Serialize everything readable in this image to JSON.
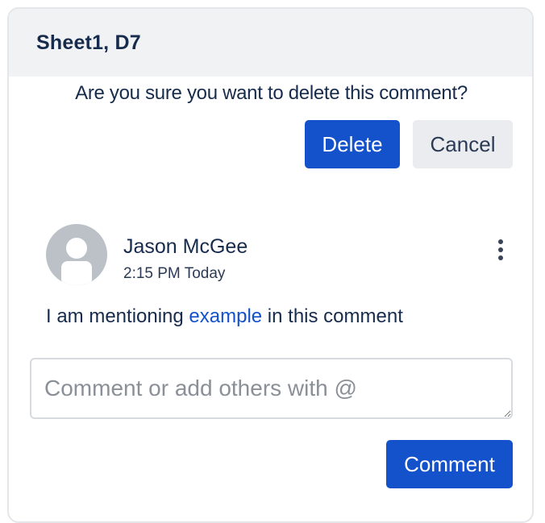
{
  "header": {
    "title": "Sheet1, D7"
  },
  "confirm_dialog": {
    "message": "Are you sure you want to delete this comment?",
    "delete_label": "Delete",
    "cancel_label": "Cancel"
  },
  "comment": {
    "author": "Jason McGee",
    "timestamp": "2:15 PM Today",
    "text_before": "I am mentioning ",
    "mention": "example",
    "text_after": " in this comment",
    "menu_icon": "more-vertical-icon",
    "avatar_icon": "user-avatar-icon"
  },
  "composer": {
    "placeholder": "Comment or add others with @",
    "value": "",
    "submit_label": "Comment"
  },
  "colors": {
    "primary": "#1452cc",
    "header_bg": "#f1f2f4",
    "text": "#172b4d",
    "avatar": "#bcc1c8"
  }
}
